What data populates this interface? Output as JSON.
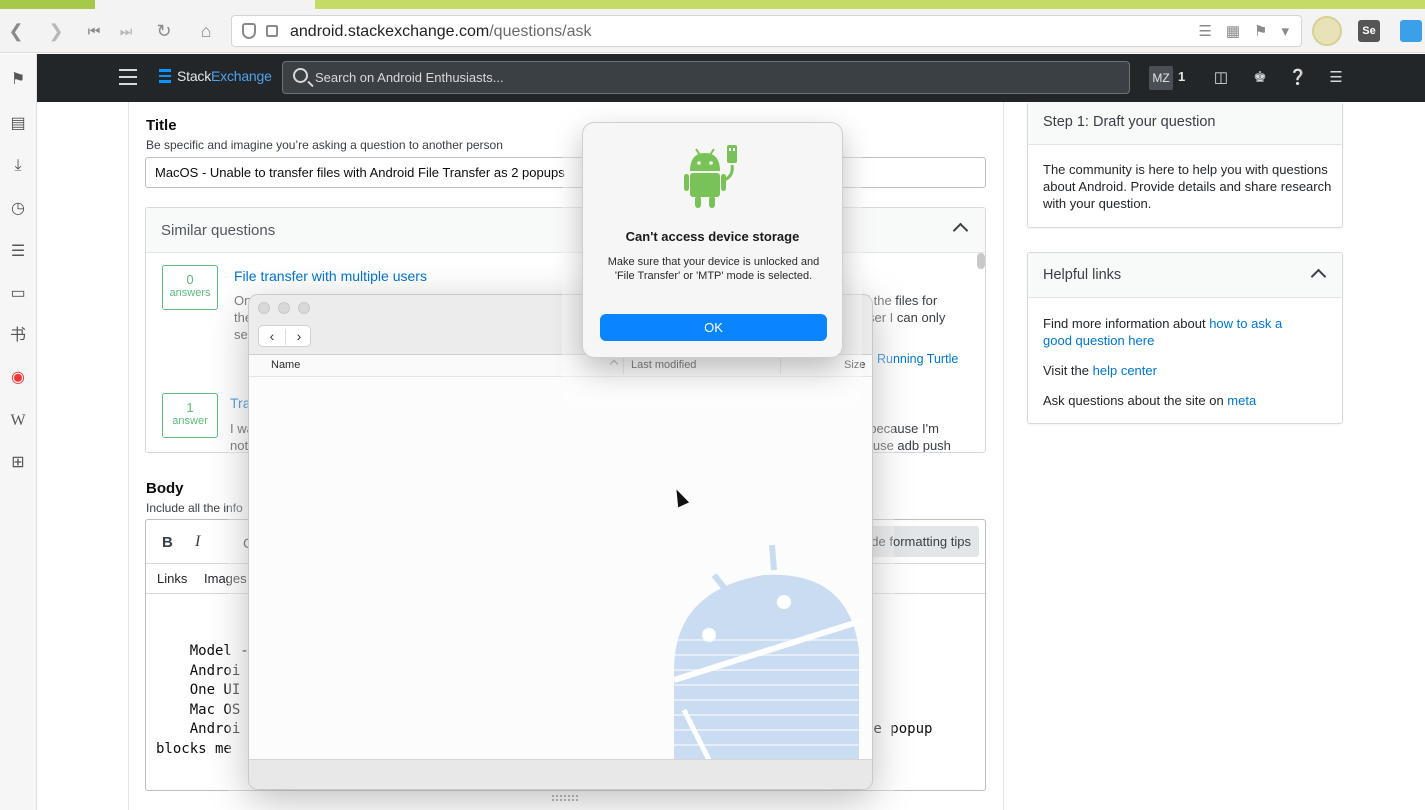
{
  "browser": {
    "url_host": "android.stackexchange.com",
    "url_path": "/questions/ask",
    "extension_label": "Se"
  },
  "topbar": {
    "logo_stack": "Stack",
    "logo_exchange": "Exchange",
    "search_placeholder": "Search on Android Enthusiasts...",
    "user_initials": "MZ",
    "reputation": "1"
  },
  "title_section": {
    "label": "Title",
    "hint": "Be specific and imagine you’re asking a question to another person",
    "value": "MacOS - Unable to transfer files with Android File Transfer as 2 popups"
  },
  "similar": {
    "heading": "Similar questions",
    "items": [
      {
        "count": "0",
        "unit": "answers",
        "title": "File transfer with multiple users",
        "line1_left": "On",
        "line2_left": "the",
        "line3_left": "se",
        "line1_right": "all the files for",
        "line2_right": "ser I can only",
        "author": "Running Turtle"
      },
      {
        "count": "1",
        "unit": "answer",
        "title": "Tra",
        "line1_left": "I wa",
        "line2_left": "not",
        "line1_right": "t because I'm",
        "line2_right": "o use adb push"
      }
    ]
  },
  "body_section": {
    "label": "Body",
    "hint": "Include all the info",
    "bold": "B",
    "italic": "I",
    "code_partial": "C",
    "formatting_tips": "de formatting tips",
    "tab_links": "Links",
    "tab_images": "Images",
    "lines": [
      "    Model -",
      "    Androi",
      "    One UI",
      "    Mac OS",
      "    Androi"
    ],
    "line5_right": "he popup",
    "line6": "blocks me "
  },
  "sidebar_cards": {
    "draft": {
      "heading": "Step 1: Draft your question",
      "text": "The community is here to help you with questions about Android. Provide details and share research with your question."
    },
    "helpful": {
      "heading": "Helpful links",
      "l1_pre": "Find more information about ",
      "l1_link": "how to ask a good question here",
      "l2_pre": "Visit the ",
      "l2_link": "help center",
      "l3_pre": "Ask questions about the site on ",
      "l3_link": "meta"
    }
  },
  "file_window": {
    "col_name": "Name",
    "col_modified": "Last modified",
    "col_size": "Size"
  },
  "alert": {
    "title": "Can't access device storage",
    "message": "Make sure that your device is unlocked and 'File Transfer' or 'MTP' mode is selected.",
    "ok_label": "OK"
  },
  "colors": {
    "se_topbar": "#232629",
    "link": "#0074cc",
    "answer_green": "#5eba7d",
    "mac_blue": "#0a84ff",
    "android_green": "#78c257"
  }
}
